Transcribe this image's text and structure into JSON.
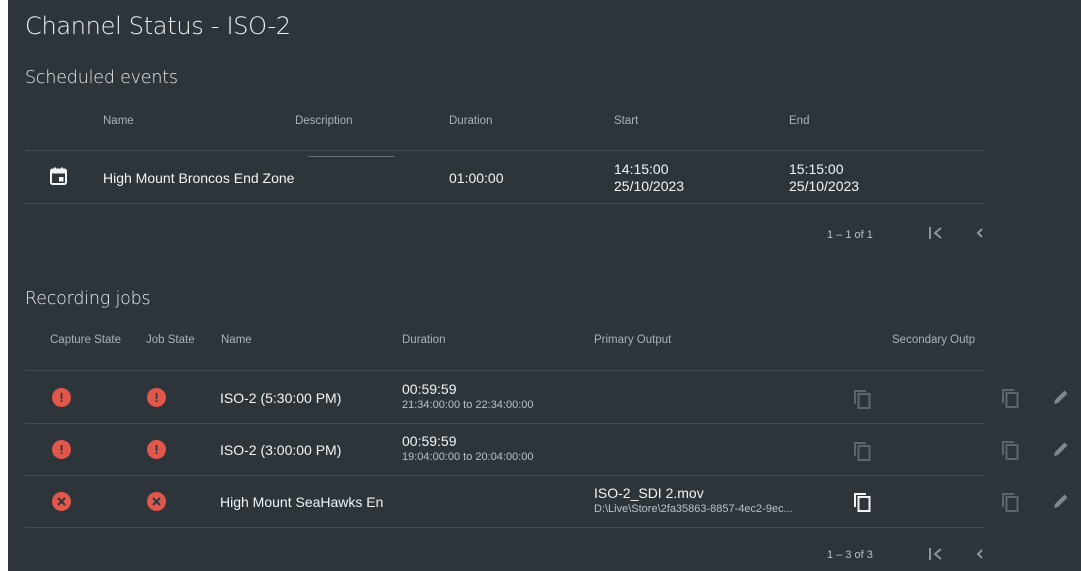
{
  "title": "Channel Status - ISO-2",
  "scheduled": {
    "heading": "Scheduled events",
    "columns": {
      "name": "Name",
      "description": "Description",
      "duration": "Duration",
      "start": "Start",
      "end": "End"
    },
    "rows": [
      {
        "icon": "calendar-icon",
        "name": "High Mount Broncos End Zone",
        "description": "",
        "duration": "01:00:00",
        "start_time": "14:15:00",
        "start_date": "25/10/2023",
        "end_time": "15:15:00",
        "end_date": "25/10/2023"
      }
    ],
    "pagination": "1 – 1 of 1"
  },
  "recording": {
    "heading": "Recording jobs",
    "columns": {
      "capture_state": "Capture State",
      "job_state": "Job State",
      "name": "Name",
      "duration": "Duration",
      "primary_output": "Primary Output",
      "secondary_output": "Secondary Outp"
    },
    "rows": [
      {
        "capture_icon": "error-icon",
        "job_icon": "error-icon",
        "name": "ISO-2 (5:30:00 PM)",
        "duration": "00:59:59",
        "range": "21:34:00:00 to 22:34:00:00",
        "primary_file": "",
        "primary_path": "",
        "copy_enabled": false
      },
      {
        "capture_icon": "error-icon",
        "job_icon": "error-icon",
        "name": "ISO-2 (3:00:00 PM)",
        "duration": "00:59:59",
        "range": "19:04:00:00 to 20:04:00:00",
        "primary_file": "",
        "primary_path": "",
        "copy_enabled": false
      },
      {
        "capture_icon": "cancel-icon",
        "job_icon": "cancel-icon",
        "name": "High Mount SeaHawks En",
        "duration": "",
        "range": "",
        "primary_file": "ISO-2_SDI 2.mov",
        "primary_path": "D:\\Live\\Store\\2fa35863-8857-4ec2-9ec...",
        "copy_enabled": true
      }
    ],
    "pagination": "1 – 3 of 3"
  },
  "colors": {
    "background": "#2d353b",
    "error": "#e2574c",
    "divider": "#434c53"
  }
}
